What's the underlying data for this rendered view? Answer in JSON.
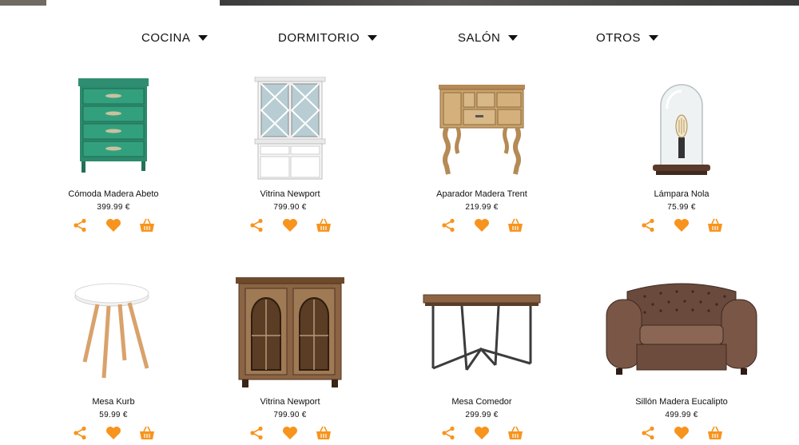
{
  "nav": {
    "items": [
      {
        "label": "COCINA"
      },
      {
        "label": "DORMITORIO"
      },
      {
        "label": "SALÓN"
      },
      {
        "label": "OTROS"
      }
    ]
  },
  "products": [
    {
      "name": "Cómoda Madera Abeto",
      "price": "399.99 €"
    },
    {
      "name": "Vitrina Newport",
      "price": "799.90 €"
    },
    {
      "name": "Aparador Madera Trent",
      "price": "219.99 €"
    },
    {
      "name": "Lámpara Nola",
      "price": "75.99 €"
    },
    {
      "name": "Mesa Kurb",
      "price": "59.99 €"
    },
    {
      "name": "Vitrina Newport",
      "price": "799.90 €"
    },
    {
      "name": "Mesa Comedor",
      "price": "299.99 €"
    },
    {
      "name": "Sillón Madera Eucalipto",
      "price": "499.99 €"
    }
  ],
  "icons": {
    "caret": "caret-down-icon",
    "share": "share-icon",
    "favorite": "heart-icon",
    "cart": "shopping-basket-icon"
  },
  "colors": {
    "accent": "#f7941d",
    "text": "#111111",
    "background": "#ffffff"
  }
}
